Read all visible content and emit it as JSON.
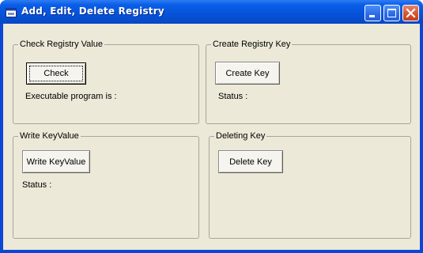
{
  "window": {
    "title": "Add, Edit, Delete Registry",
    "icon": "vb-form-icon",
    "controls": [
      "minimize-icon",
      "maximize-icon",
      "close-icon"
    ]
  },
  "frames": {
    "check": {
      "caption": "Check Registry Value",
      "button_label": "Check",
      "result_label": "Executable program is :"
    },
    "create": {
      "caption": "Create Registry Key",
      "button_label": "Create Key",
      "status_label": "Status :"
    },
    "write": {
      "caption": "Write KeyValue",
      "button_label": "Write KeyValue",
      "status_label": "Status :"
    },
    "delete": {
      "caption": "Deleting Key",
      "button_label": "Delete Key"
    }
  },
  "colors": {
    "titlebar": "#0653d8",
    "client": "#ece9d8",
    "close_button": "#d5502c"
  }
}
